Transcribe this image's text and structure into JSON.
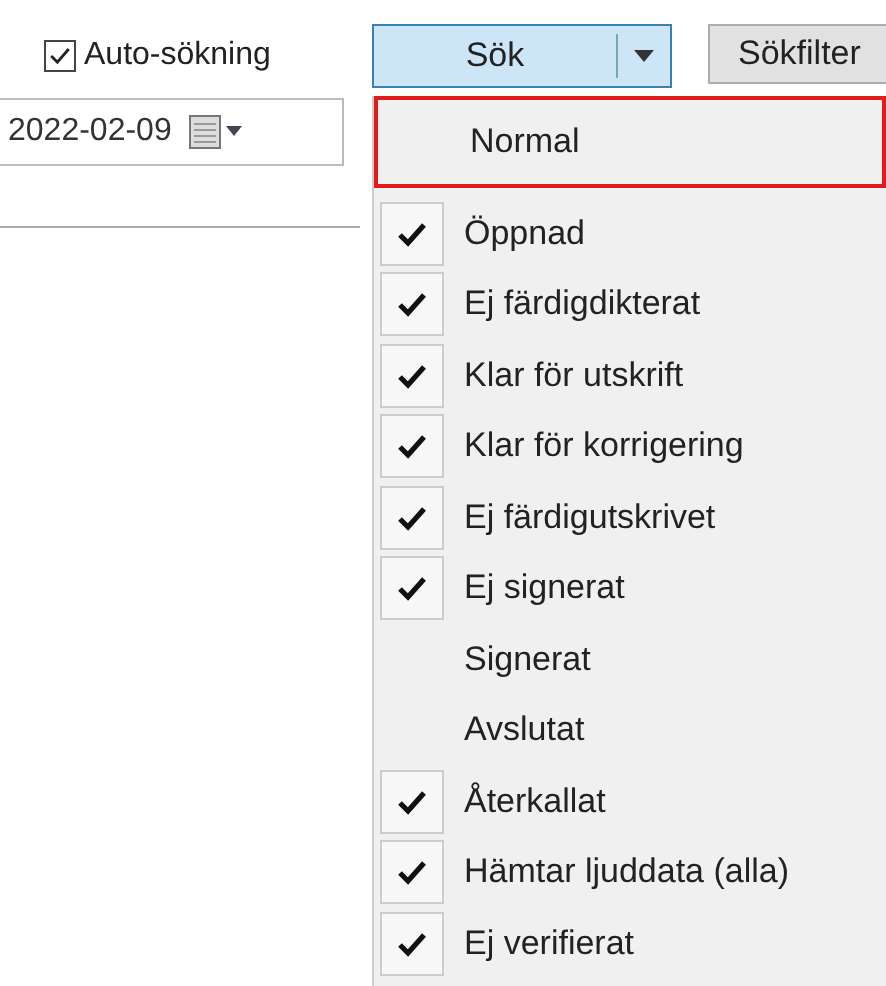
{
  "auto_search": {
    "label": "Auto-sökning",
    "checked": true
  },
  "search_button": {
    "label": "Sök"
  },
  "filter_button": {
    "label": "Sökfilter"
  },
  "date_field": {
    "value": "2022-02-09"
  },
  "menu": {
    "normal": {
      "label": "Normal",
      "outlined": true
    },
    "items": [
      {
        "label": "Öppnad",
        "checked": true
      },
      {
        "label": "Ej färdigdikterat",
        "checked": true
      },
      {
        "label": "Klar för utskrift",
        "checked": true
      },
      {
        "label": "Klar för korrigering",
        "checked": true
      },
      {
        "label": "Ej färdigutskrivet",
        "checked": true
      },
      {
        "label": "Ej signerat",
        "checked": true
      },
      {
        "label": "Signerat",
        "checked": false
      },
      {
        "label": "Avslutat",
        "checked": false
      },
      {
        "label": "Återkallat",
        "checked": true
      },
      {
        "label": "Hämtar ljuddata (alla)",
        "checked": true
      },
      {
        "label": "Ej verifierat",
        "checked": true
      }
    ]
  }
}
